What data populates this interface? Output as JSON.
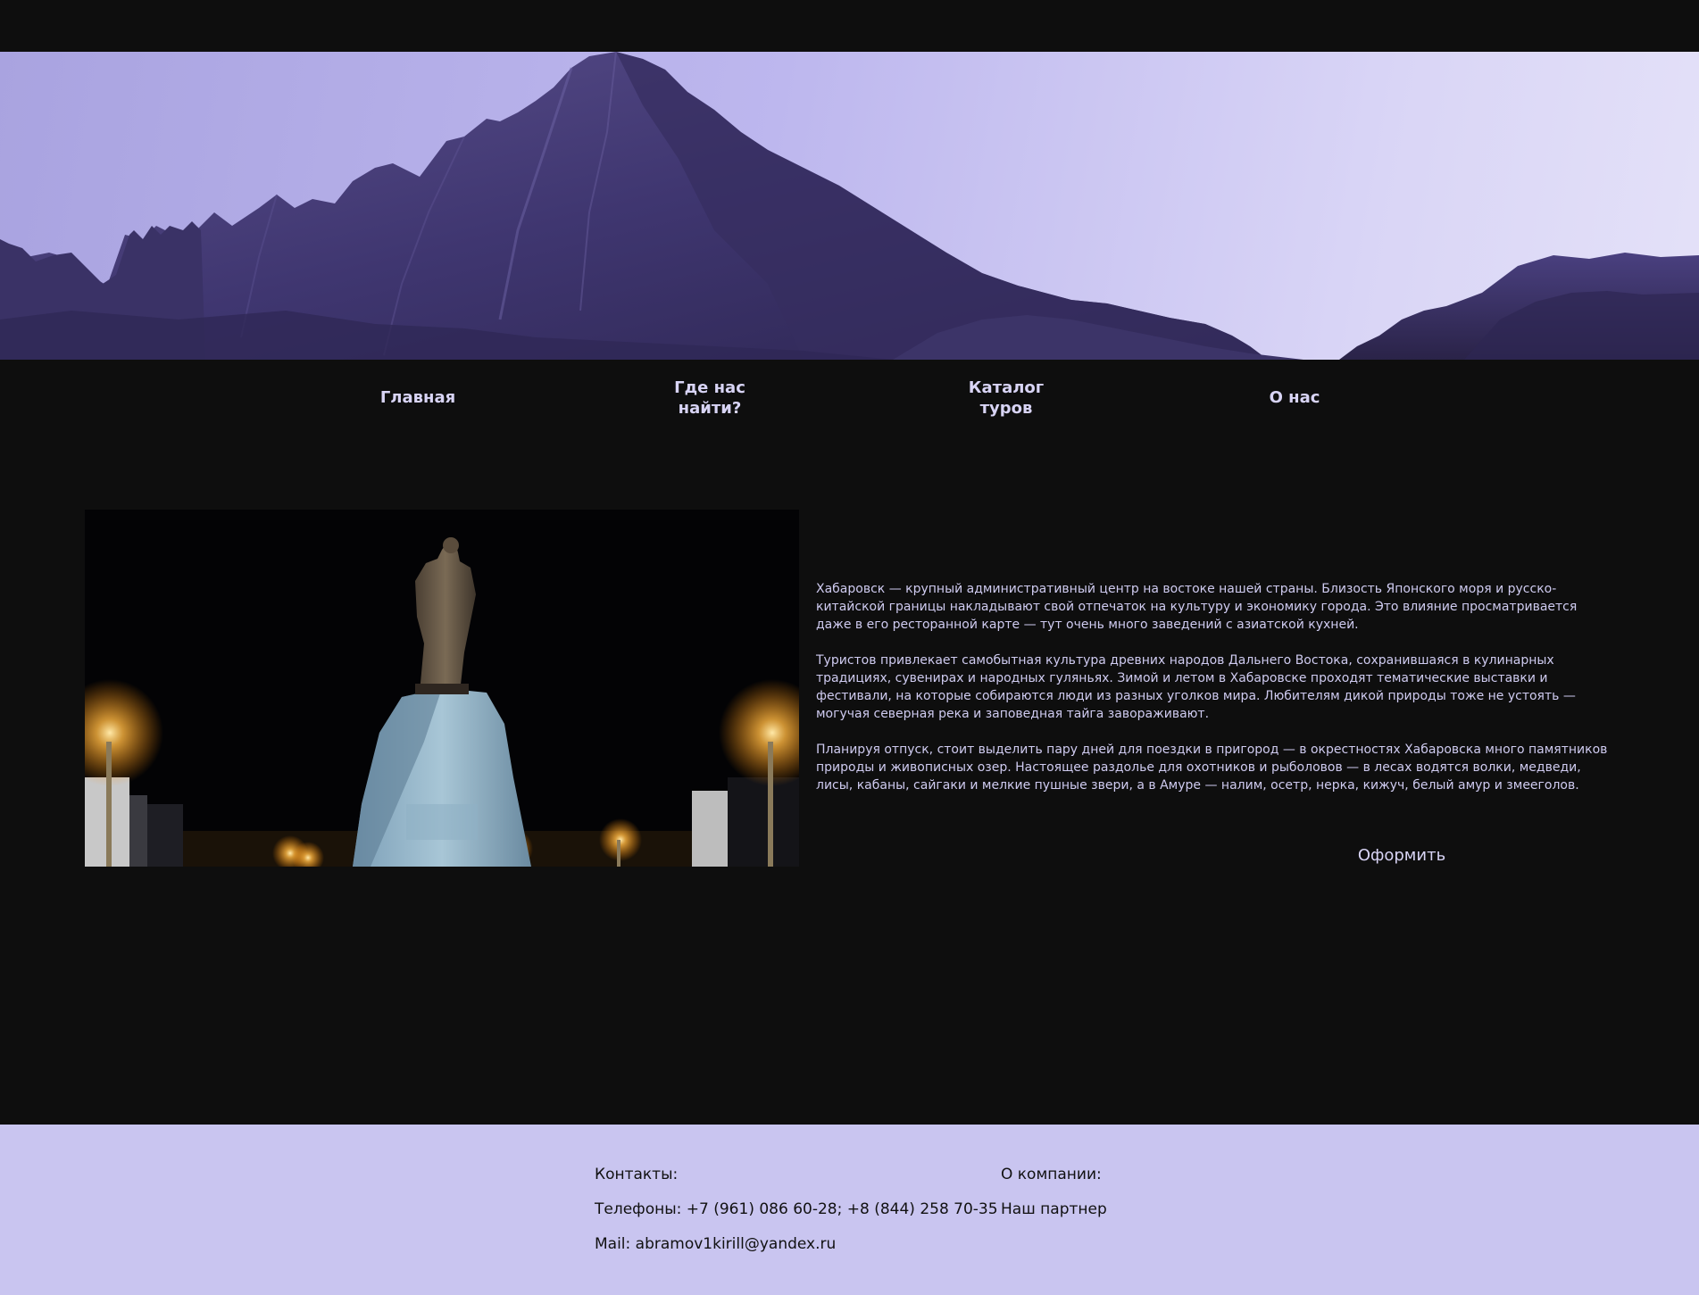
{
  "nav": {
    "items": [
      {
        "label_line1": "Главная",
        "label_line2": ""
      },
      {
        "label_line1": "Где нас",
        "label_line2": "найти?"
      },
      {
        "label_line1": "Каталог",
        "label_line2": "туров"
      },
      {
        "label_line1": "О нас",
        "label_line2": ""
      }
    ]
  },
  "hero": {
    "image": "mountain-panorama"
  },
  "main": {
    "photo": "khabarovsk-monument-night",
    "paragraphs": [
      "Хабаровск — крупный административный центр на востоке нашей страны. Близость Японского моря и русско-китайской границы накладывают свой отпечаток на культуру и экономику города. Это влияние просматривается даже в его ресторанной карте — тут очень много заведений с азиатской кухней.",
      "Туристов привлекает самобытная культура древних народов Дальнего Востока, сохранившаяся в кулинарных традициях, сувенирах и народных гуляньях. Зимой и летом в Хабаровске проходят тематические выставки и фестивали, на которые собираются люди из разных уголков мира. Любителям дикой природы тоже не устоять — могучая северная река и заповедная тайга завораживают.",
      "Планируя отпуск, стоит выделить пару дней для поездки в пригород — в окрестностях Хабаровска много памятников природы и живописных озер. Настоящее раздолье для охотников и рыболовов — в лесах водятся волки, медведи, лисы, кабаны, сайгаки и мелкие пушные звери, а в Амуре — налим, осетр, нерка, кижуч, белый амур и змееголов."
    ],
    "order_button": "Оформить"
  },
  "footer": {
    "contacts_title": "Контакты:",
    "phones": "Телефоны: +7 (961) 086 60-28; +8 (844) 258 70-35",
    "mail": "Mail: abramov1kirill@yandex.ru",
    "company_title": "О компании:",
    "partner": "Наш партнер"
  },
  "colors": {
    "background": "#0e0e0e",
    "accent": "#d8d4f5",
    "footer_bg": "#c9c5f0"
  }
}
